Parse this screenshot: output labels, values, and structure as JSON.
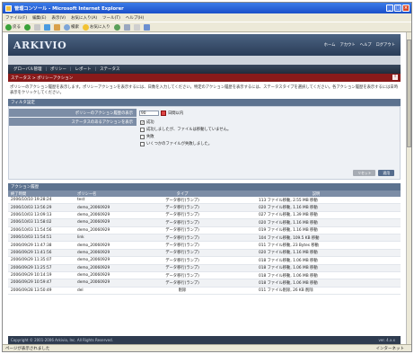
{
  "window": {
    "title": "管理コンソール - Microsoft Internet Explorer",
    "min": "_",
    "max": "□",
    "close": "×"
  },
  "menu": [
    "ファイル(F)",
    "編集(E)",
    "表示(V)",
    "お気に入り(A)",
    "ツール(T)",
    "ヘルプ(H)"
  ],
  "toolbar": {
    "back": "戻る",
    "search": "検索",
    "favorites": "お気に入り"
  },
  "app": {
    "logo": "ARKIVIO",
    "top_links": [
      "ホーム",
      "アカウト",
      "ヘルプ",
      "ログアウト"
    ],
    "nav": [
      "グローバル管理",
      "ポリシー",
      "レポート",
      "ステータス"
    ],
    "breadcrumb": "ステータス > ポリシーアクション",
    "alert": "!",
    "intro": "ポリシーのアクション履歴を表示します。ポリシーアクションを表示するには、日数を入力してください。特定のアクション履歴を表示するには、ステータスタイプを選択してください。各アクション履歴を表示するには日時表示をクリックしてください。",
    "filter": {
      "header": "フィルタ設定",
      "days_label": "ポリシーのアクション履歴の表示",
      "days_value": "90",
      "days_unit": "日間以内",
      "status_label": "ステータスのあるアクションを表示",
      "options": [
        {
          "label": "成功",
          "checked": true
        },
        {
          "label": "成功しましたが、ファイルは移動していません。",
          "checked": false
        },
        {
          "label": "失敗",
          "checked": false
        },
        {
          "label": "いくつかのファイルが失敗しました。",
          "checked": false
        }
      ],
      "reset_label": "リセット",
      "apply_label": "適用"
    },
    "history": {
      "header": "アクション履歴",
      "columns": [
        "終了時間",
        "ポリシー名",
        "タイプ",
        "説明"
      ],
      "rows": [
        [
          "2006/10/10 19:28:24",
          "test",
          "データ移行(ランプ)",
          "113 ファイル移動, 2.55 MB 移動"
        ],
        [
          "2006/10/03 13:56:29",
          "demo_20060929",
          "データ移行(ランプ)",
          "020 ファイル移動, 1.16 MB 移動"
        ],
        [
          "2006/10/03 13:09:13",
          "demo_20060929",
          "データ移行(ランプ)",
          "027 ファイル移動, 1.39 MB 移動"
        ],
        [
          "2006/10/03 11:58:02",
          "demo_20060929",
          "データ移行(ランプ)",
          "020 ファイル移動, 1.16 MB 移動"
        ],
        [
          "2006/10/03 11:54:56",
          "demo_20060929",
          "データ移行(ランプ)",
          "019 ファイル移動, 1.16 MB 移動"
        ],
        [
          "2006/10/03 11:54:51",
          "link",
          "データ移行(ランプ)",
          "104 ファイル移動, 109.5 KB 移動"
        ],
        [
          "2006/09/29 11:47:38",
          "demo_20060929",
          "データ移行(ランプ)",
          "011 ファイル移動, 23 Bytes 移動"
        ],
        [
          "2006/09/29 11:41:56",
          "demo_20060929",
          "データ移行(ランプ)",
          "020 ファイル移動, 1.16 MB 移動"
        ],
        [
          "2006/09/29 11:35:07",
          "demo_20060929",
          "データ移行(ランプ)",
          "018 ファイル移動, 1.06 MB 移動"
        ],
        [
          "2006/09/29 11:25:57",
          "demo_20060929",
          "データ移行(ランプ)",
          "018 ファイル移動, 1.06 MB 移動"
        ],
        [
          "2006/09/29 10:14:19",
          "demo_20060929",
          "データ移行(ランプ)",
          "018 ファイル移動, 1.06 MB 移動"
        ],
        [
          "2006/09/29 10:59:47",
          "demo_20060929",
          "データ移行(ランプ)",
          "018 ファイル移動, 1.06 MB 移動"
        ],
        [
          "2006/09/28 13:50:49",
          "del",
          "削除",
          "011 ファイル削除, 26 KB 削除"
        ]
      ]
    },
    "footer": {
      "copyright": "Copyright © 2001-2006 Arkivio, Inc. All Rights Reserved.",
      "version": "ver. 4.x.x"
    }
  },
  "status": {
    "text": "ページが表示されました",
    "zone": "インターネット"
  }
}
